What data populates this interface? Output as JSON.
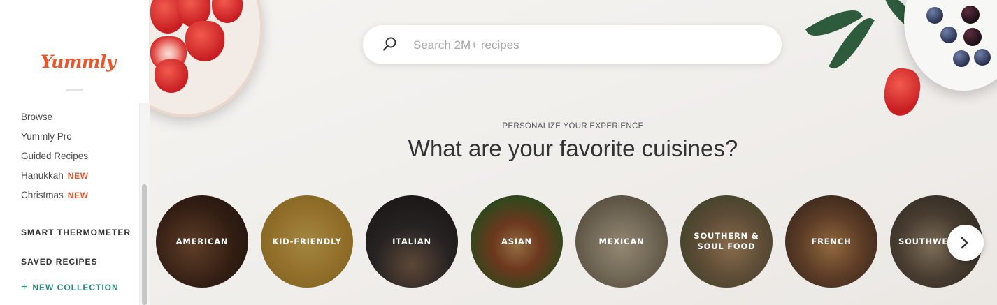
{
  "brand": {
    "logo_text": "Yummly",
    "accent": "#e8562a",
    "teal": "#2a8a7c"
  },
  "sidebar": {
    "items": [
      {
        "label": "Browse",
        "badge": ""
      },
      {
        "label": "Yummly Pro",
        "badge": ""
      },
      {
        "label": "Guided Recipes",
        "badge": ""
      },
      {
        "label": "Hanukkah",
        "badge": "NEW"
      },
      {
        "label": "Christmas",
        "badge": "NEW"
      }
    ],
    "sections": [
      {
        "label": "SMART THERMOMETER"
      },
      {
        "label": "SAVED RECIPES"
      }
    ],
    "new_collection": {
      "icon": "plus-icon",
      "label": "NEW COLLECTION"
    }
  },
  "search": {
    "placeholder": "Search 2M+ recipes",
    "value": "",
    "icon": "search-icon"
  },
  "personalize": {
    "eyebrow": "PERSONALIZE YOUR EXPERIENCE",
    "headline": "What are your favorite cuisines?"
  },
  "cuisines": [
    {
      "label": "AMERICAN",
      "bg": "#5a3a28"
    },
    {
      "label": "KID-FRIENDLY",
      "bg": "#c9a24a"
    },
    {
      "label": "ITALIAN",
      "bg": "#3b3434"
    },
    {
      "label": "ASIAN",
      "bg": "#7a5a3a"
    },
    {
      "label": "MEXICAN",
      "bg": "#8a7a62"
    },
    {
      "label": "SOUTHERN & SOUL FOOD",
      "bg": "#7c6a4c"
    },
    {
      "label": "FRENCH",
      "bg": "#6a5040"
    },
    {
      "label": "SOUTHWESTERN",
      "bg": "#4a4038"
    }
  ],
  "carousel": {
    "next_icon": "chevron-right-icon"
  }
}
